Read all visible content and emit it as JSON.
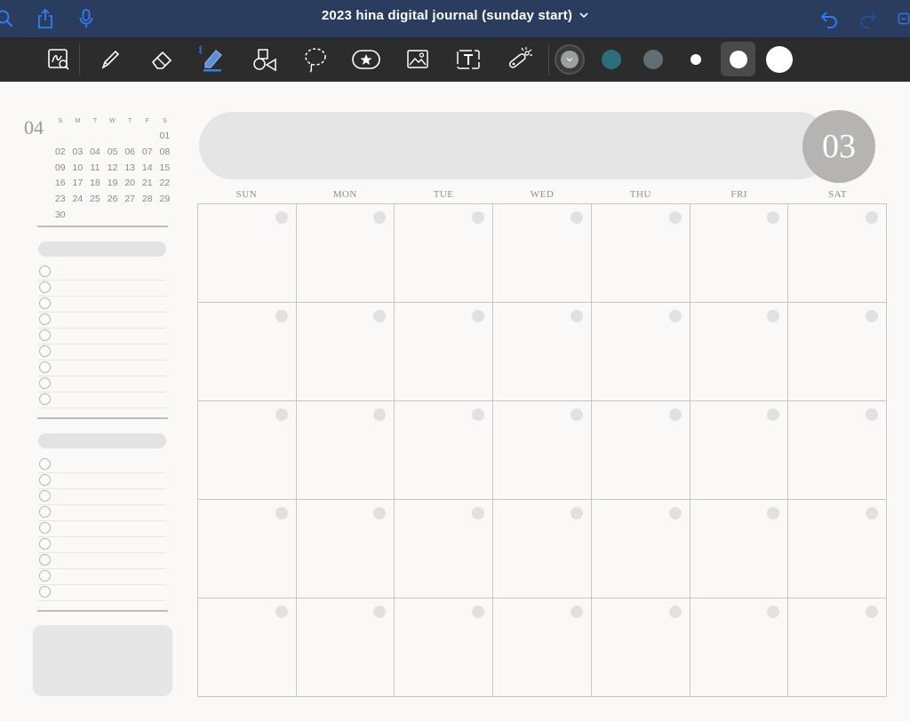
{
  "nav": {
    "title": "2023 hina digital journal (sunday start)",
    "left_icons": [
      "search-icon",
      "share-icon",
      "microphone-icon"
    ],
    "right_icons": [
      "undo-icon",
      "redo-icon"
    ],
    "accent": "#2f7df6",
    "background": "#2a3d5e"
  },
  "toolbar": {
    "tools": [
      "zoom-window-icon",
      "pen-icon",
      "eraser-icon",
      "highlighter-icon",
      "shapes-icon",
      "lasso-icon",
      "sticker-icon",
      "image-icon",
      "text-icon",
      "laser-pointer-icon"
    ],
    "active_tool": "highlighter-icon",
    "colors": [
      "#9aa0a2",
      "#2c6e7a",
      "#5f6f73"
    ],
    "sizes": [
      "small",
      "medium",
      "large"
    ],
    "selected_size": "medium"
  },
  "mini_calendar": {
    "month": "04",
    "weekdays": [
      "S",
      "M",
      "T",
      "W",
      "T",
      "F",
      "S"
    ],
    "days": [
      "",
      "",
      "",
      "",
      "",
      "",
      "01",
      "02",
      "03",
      "04",
      "05",
      "06",
      "07",
      "08",
      "09",
      "10",
      "11",
      "12",
      "13",
      "14",
      "15",
      "16",
      "17",
      "18",
      "19",
      "20",
      "21",
      "22",
      "23",
      "24",
      "25",
      "26",
      "27",
      "28",
      "29",
      "30",
      "",
      "",
      "",
      "",
      "",
      ""
    ]
  },
  "calendar": {
    "month_number": "03",
    "weekdays": [
      "SUN",
      "MON",
      "TUE",
      "WED",
      "THU",
      "FRI",
      "SAT"
    ]
  }
}
